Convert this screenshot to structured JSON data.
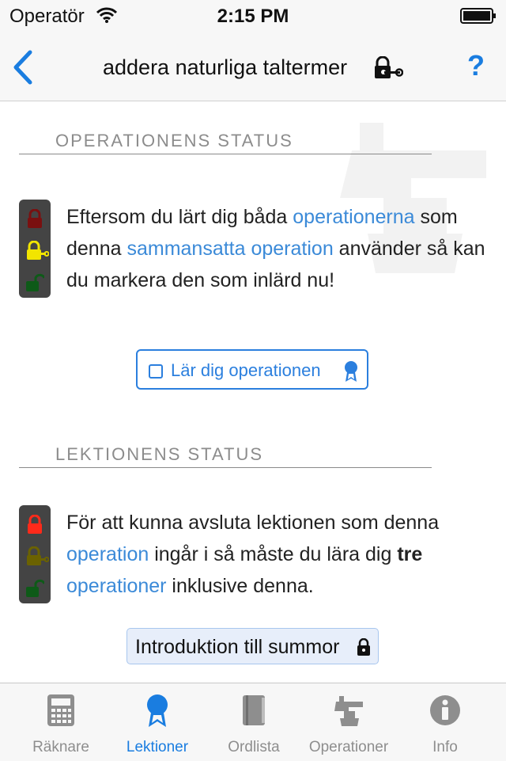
{
  "status_bar": {
    "carrier": "Operatör",
    "time": "2:15 PM"
  },
  "nav": {
    "title": "addera naturliga taltermer",
    "help": "?"
  },
  "operation_status": {
    "header": "OPERATIONENS STATUS",
    "text_1": "Eftersom du lärt dig båda ",
    "link_1": "operationerna",
    "text_2": " som denna ",
    "link_2": "sammansatta operation",
    "text_3": " använder så kan du markera den som inlärd nu!",
    "learn_button": "Lär dig operationen"
  },
  "lesson_status": {
    "header": "LEKTIONENS STATUS",
    "text_1": "För att kunna avsluta lektionen som denna ",
    "link_1": "operation",
    "text_2": " ingår i så måste du lära dig ",
    "bold_1": "tre",
    "link_2": "operationer",
    "text_3": " inklusive denna.",
    "lesson_button": "Introduktion till summor"
  },
  "tabs": [
    {
      "label": "Räknare",
      "icon": "calculator-icon",
      "active": false
    },
    {
      "label": "Lektioner",
      "icon": "ribbon-icon",
      "active": true
    },
    {
      "label": "Ordlista",
      "icon": "book-icon",
      "active": false
    },
    {
      "label": "Operationer",
      "icon": "anvil-icon",
      "active": false
    },
    {
      "label": "Info",
      "icon": "info-icon",
      "active": false
    }
  ],
  "colors": {
    "accent": "#1a7de0",
    "link": "#3b8ad8",
    "traffic_red": "#ff2a1a",
    "traffic_yellow": "#f2e500",
    "traffic_green": "#1f9d2a"
  }
}
